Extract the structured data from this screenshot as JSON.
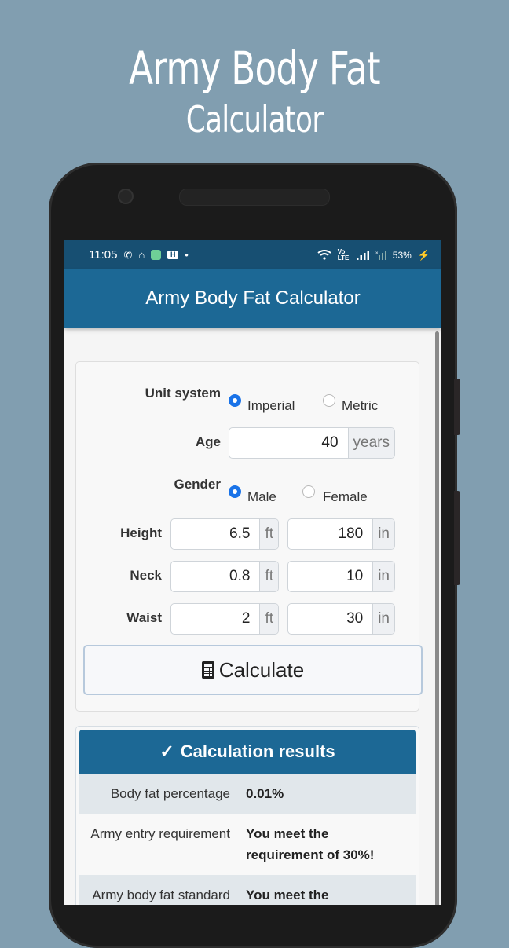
{
  "promo": {
    "title": "Army Body Fat",
    "subtitle": "Calculator"
  },
  "status_bar": {
    "time": "11:05",
    "left_icons": [
      "whatsapp-icon",
      "home-icon",
      "app-green-icon",
      "h-badge-icon",
      "dot-icon"
    ],
    "right_icons": [
      "wifi-icon",
      "volte-icon",
      "signal-icon",
      "no-signal-icon",
      "charging-icon"
    ],
    "volte_label": "Vo LTE",
    "battery": "53%"
  },
  "app_bar": {
    "title": "Army Body Fat Calculator"
  },
  "form": {
    "unit_system": {
      "label": "Unit system",
      "options": [
        {
          "label": "Imperial",
          "selected": true
        },
        {
          "label": "Metric",
          "selected": false
        }
      ]
    },
    "age": {
      "label": "Age",
      "value": "40",
      "unit": "years"
    },
    "gender": {
      "label": "Gender",
      "options": [
        {
          "label": "Male",
          "selected": true
        },
        {
          "label": "Female",
          "selected": false
        }
      ]
    },
    "height": {
      "label": "Height",
      "ft_value": "6.5",
      "ft_unit": "ft",
      "in_value": "180",
      "in_unit": "in"
    },
    "neck": {
      "label": "Neck",
      "ft_value": "0.8",
      "ft_unit": "ft",
      "in_value": "10",
      "in_unit": "in"
    },
    "waist": {
      "label": "Waist",
      "ft_value": "2",
      "ft_unit": "ft",
      "in_value": "30",
      "in_unit": "in"
    },
    "calculate_label": "Calculate"
  },
  "results": {
    "header": "Calculation results",
    "check_glyph": "✓",
    "rows": [
      {
        "key": "Body fat percentage",
        "value": "0.01%"
      },
      {
        "key": "Army entry requirement",
        "value": "You meet the requirement of 30%!"
      },
      {
        "key": "Army body fat standard",
        "value": "You meet the"
      }
    ]
  },
  "colors": {
    "background": "#819eb0",
    "status_bar": "#174f72",
    "app_bar": "#1c6895",
    "radio_selected": "#1a73e8"
  }
}
